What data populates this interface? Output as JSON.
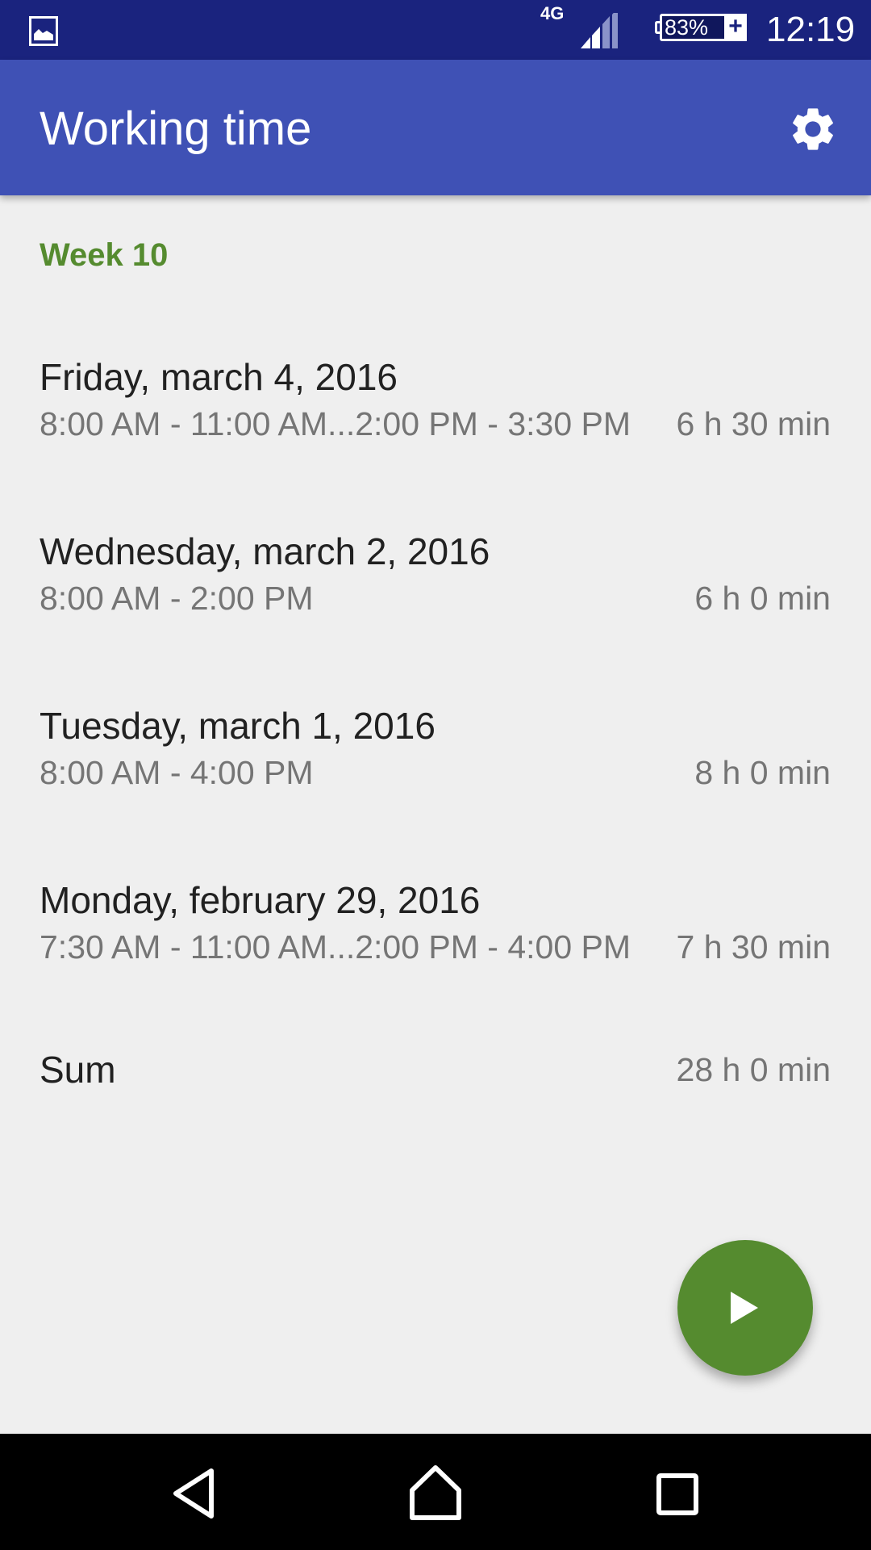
{
  "status_bar": {
    "notification_icon": "image-icon",
    "network": "4G",
    "signal_icon": "cell-signal-icon",
    "battery_percent": "83%",
    "battery_charging": "+",
    "time": "12:19"
  },
  "app_bar": {
    "title": "Working time",
    "settings_icon": "gear-icon"
  },
  "colors": {
    "status_bar": "#1a237e",
    "primary": "#3f51b5",
    "accent": "#558b2f",
    "background": "#efefef",
    "text_primary": "#212121",
    "text_secondary": "#757575"
  },
  "week": {
    "label": "Week 10"
  },
  "days": [
    {
      "title": "Friday, march 4, 2016",
      "times": "8:00 AM - 11:00 AM...2:00 PM - 3:30 PM",
      "duration": "6 h 30 min"
    },
    {
      "title": "Wednesday, march 2, 2016",
      "times": "8:00 AM - 2:00 PM",
      "duration": "6 h 0 min"
    },
    {
      "title": "Tuesday, march 1, 2016",
      "times": "8:00 AM - 4:00 PM",
      "duration": "8 h 0 min"
    },
    {
      "title": "Monday, february 29, 2016",
      "times": "7:30 AM - 11:00 AM...2:00 PM - 4:00 PM",
      "duration": "7 h 30 min"
    }
  ],
  "sum": {
    "label": "Sum",
    "value": "28 h 0 min"
  },
  "fab": {
    "icon": "play-icon"
  },
  "nav_bar": {
    "back": "back-icon",
    "home": "home-icon",
    "recents": "recents-icon"
  }
}
